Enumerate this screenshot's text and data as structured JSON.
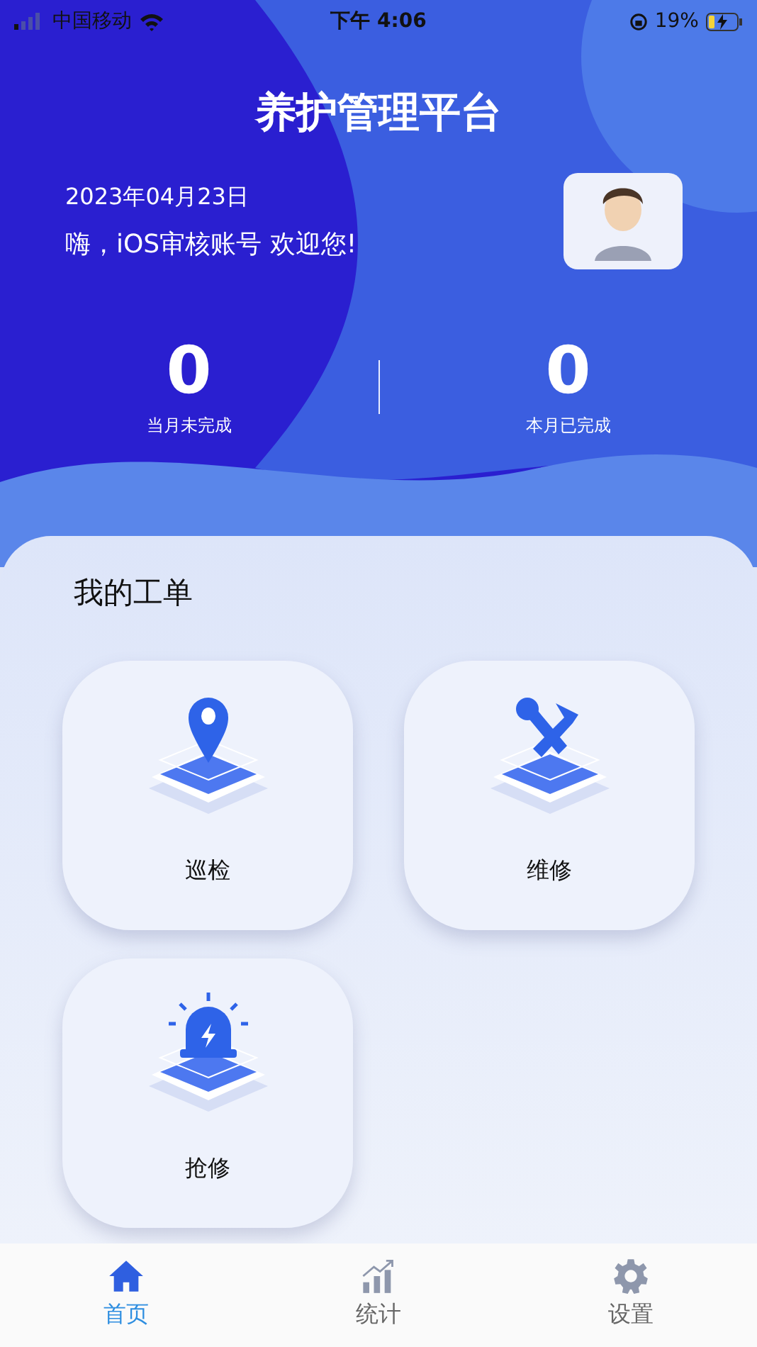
{
  "status_bar": {
    "carrier": "中国移动",
    "time": "下午 4:06",
    "battery": "19%"
  },
  "header": {
    "title": "养护管理平台",
    "date": "2023年04月23日",
    "greeting": "嗨，iOS审核账号  欢迎您!"
  },
  "stats": [
    {
      "value": "0",
      "label": "当月未完成"
    },
    {
      "value": "0",
      "label": "本月已完成"
    }
  ],
  "work_orders": {
    "title": "我的工单",
    "items": [
      {
        "kind": "pin",
        "label": "巡检"
      },
      {
        "kind": "tools",
        "label": "维修"
      },
      {
        "kind": "alarm",
        "label": "抢修"
      }
    ]
  },
  "tab_bar": [
    {
      "kind": "home",
      "label": "首页",
      "selected": true
    },
    {
      "kind": "chart",
      "label": "统计",
      "selected": false
    },
    {
      "kind": "gear",
      "label": "设置",
      "selected": false
    }
  ]
}
